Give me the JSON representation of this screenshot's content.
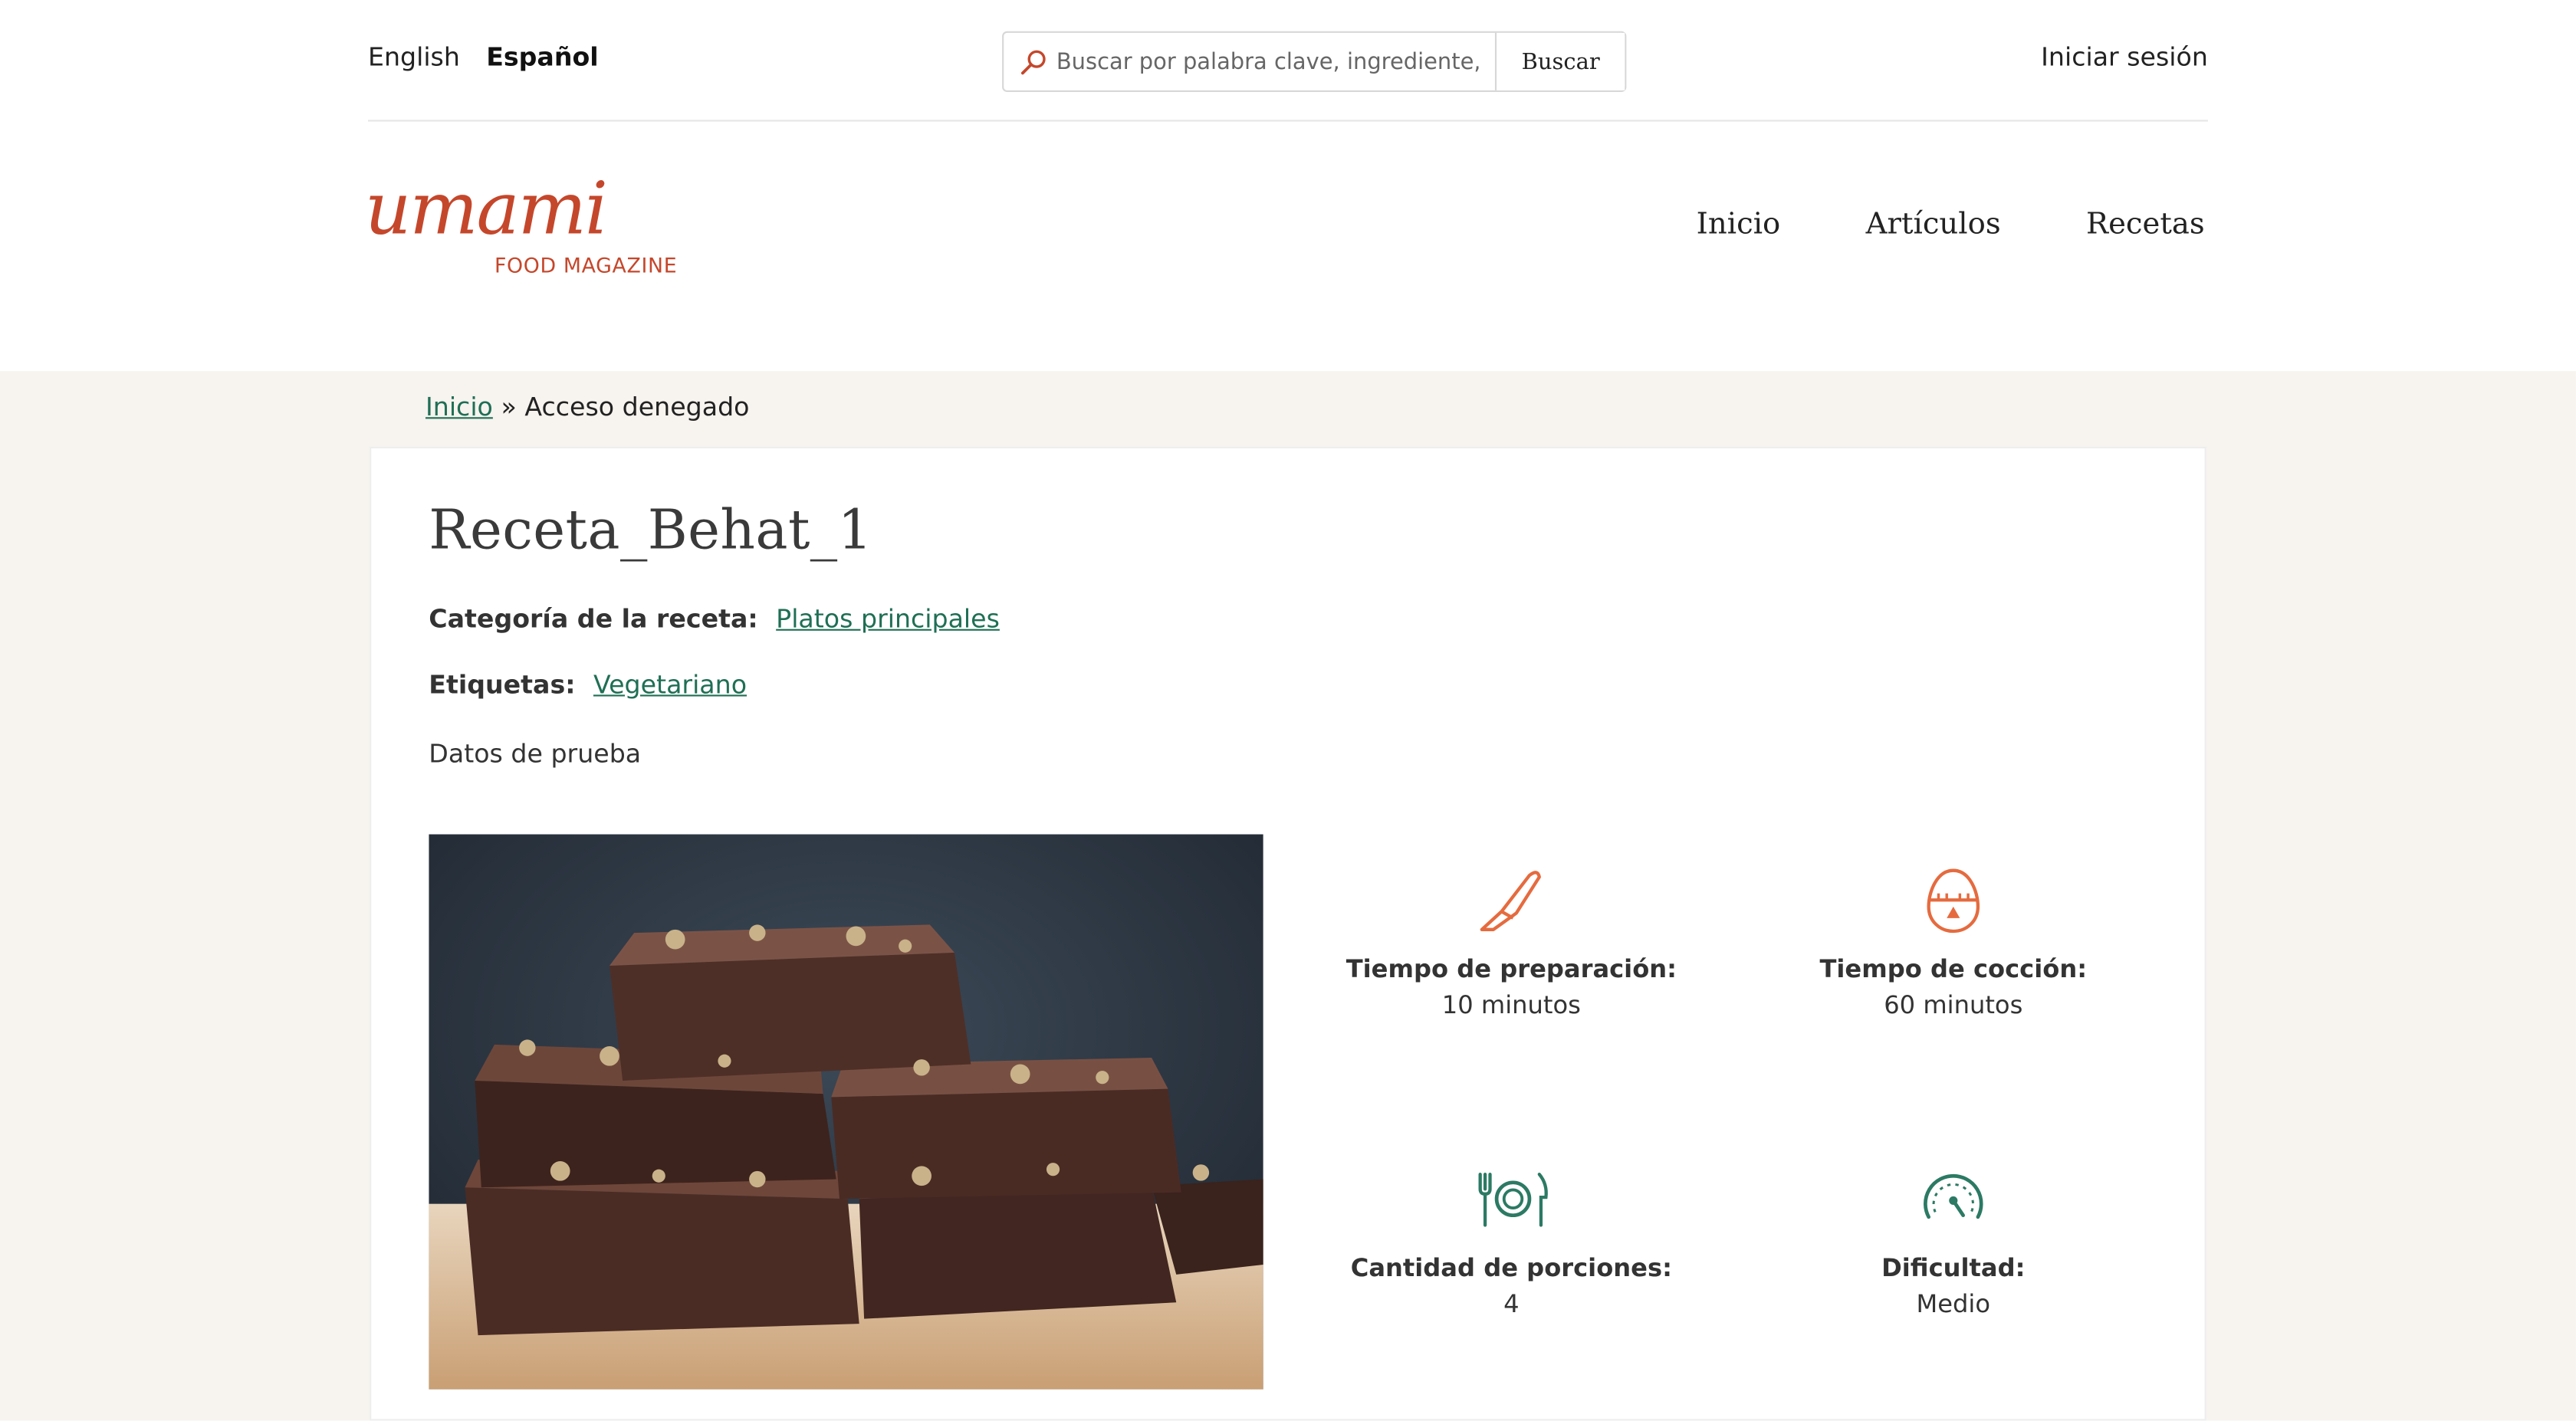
{
  "languages": [
    {
      "label": "English",
      "active": false
    },
    {
      "label": "Español",
      "active": true
    }
  ],
  "search": {
    "placeholder": "Buscar por palabra clave, ingrediente, plat",
    "button_label": "Buscar"
  },
  "login_label": "Iniciar sesión",
  "logo": {
    "word": "umami",
    "subtitle": "FOOD MAGAZINE"
  },
  "nav": [
    {
      "label": "Inicio"
    },
    {
      "label": "Artículos"
    },
    {
      "label": "Recetas"
    }
  ],
  "breadcrumb": {
    "home": "Inicio",
    "separator": "»",
    "current": "Acceso denegado"
  },
  "recipe": {
    "title": "Receta_Behat_1",
    "category_label": "Categoría de la receta:",
    "category_value": "Platos principales",
    "tags_label": "Etiquetas:",
    "tags_value": "Vegetariano",
    "description": "Datos de prueba",
    "stats": [
      {
        "icon": "knife-icon",
        "label": "Tiempo de preparación:",
        "value": "10 minutos",
        "color": "#e56b3f"
      },
      {
        "icon": "egg-timer-icon",
        "label": "Tiempo de cocción:",
        "value": "60 minutos",
        "color": "#e56b3f"
      },
      {
        "icon": "plate-cutlery-icon",
        "label": "Cantidad de porciones:",
        "value": "4",
        "color": "#2c7a63"
      },
      {
        "icon": "gauge-icon",
        "label": "Dificultad:",
        "value": "Medio",
        "color": "#2c7a63"
      }
    ]
  },
  "colors": {
    "brand": "#c5472b",
    "link": "#1f6f55",
    "page_bg": "#f7f3ee"
  }
}
